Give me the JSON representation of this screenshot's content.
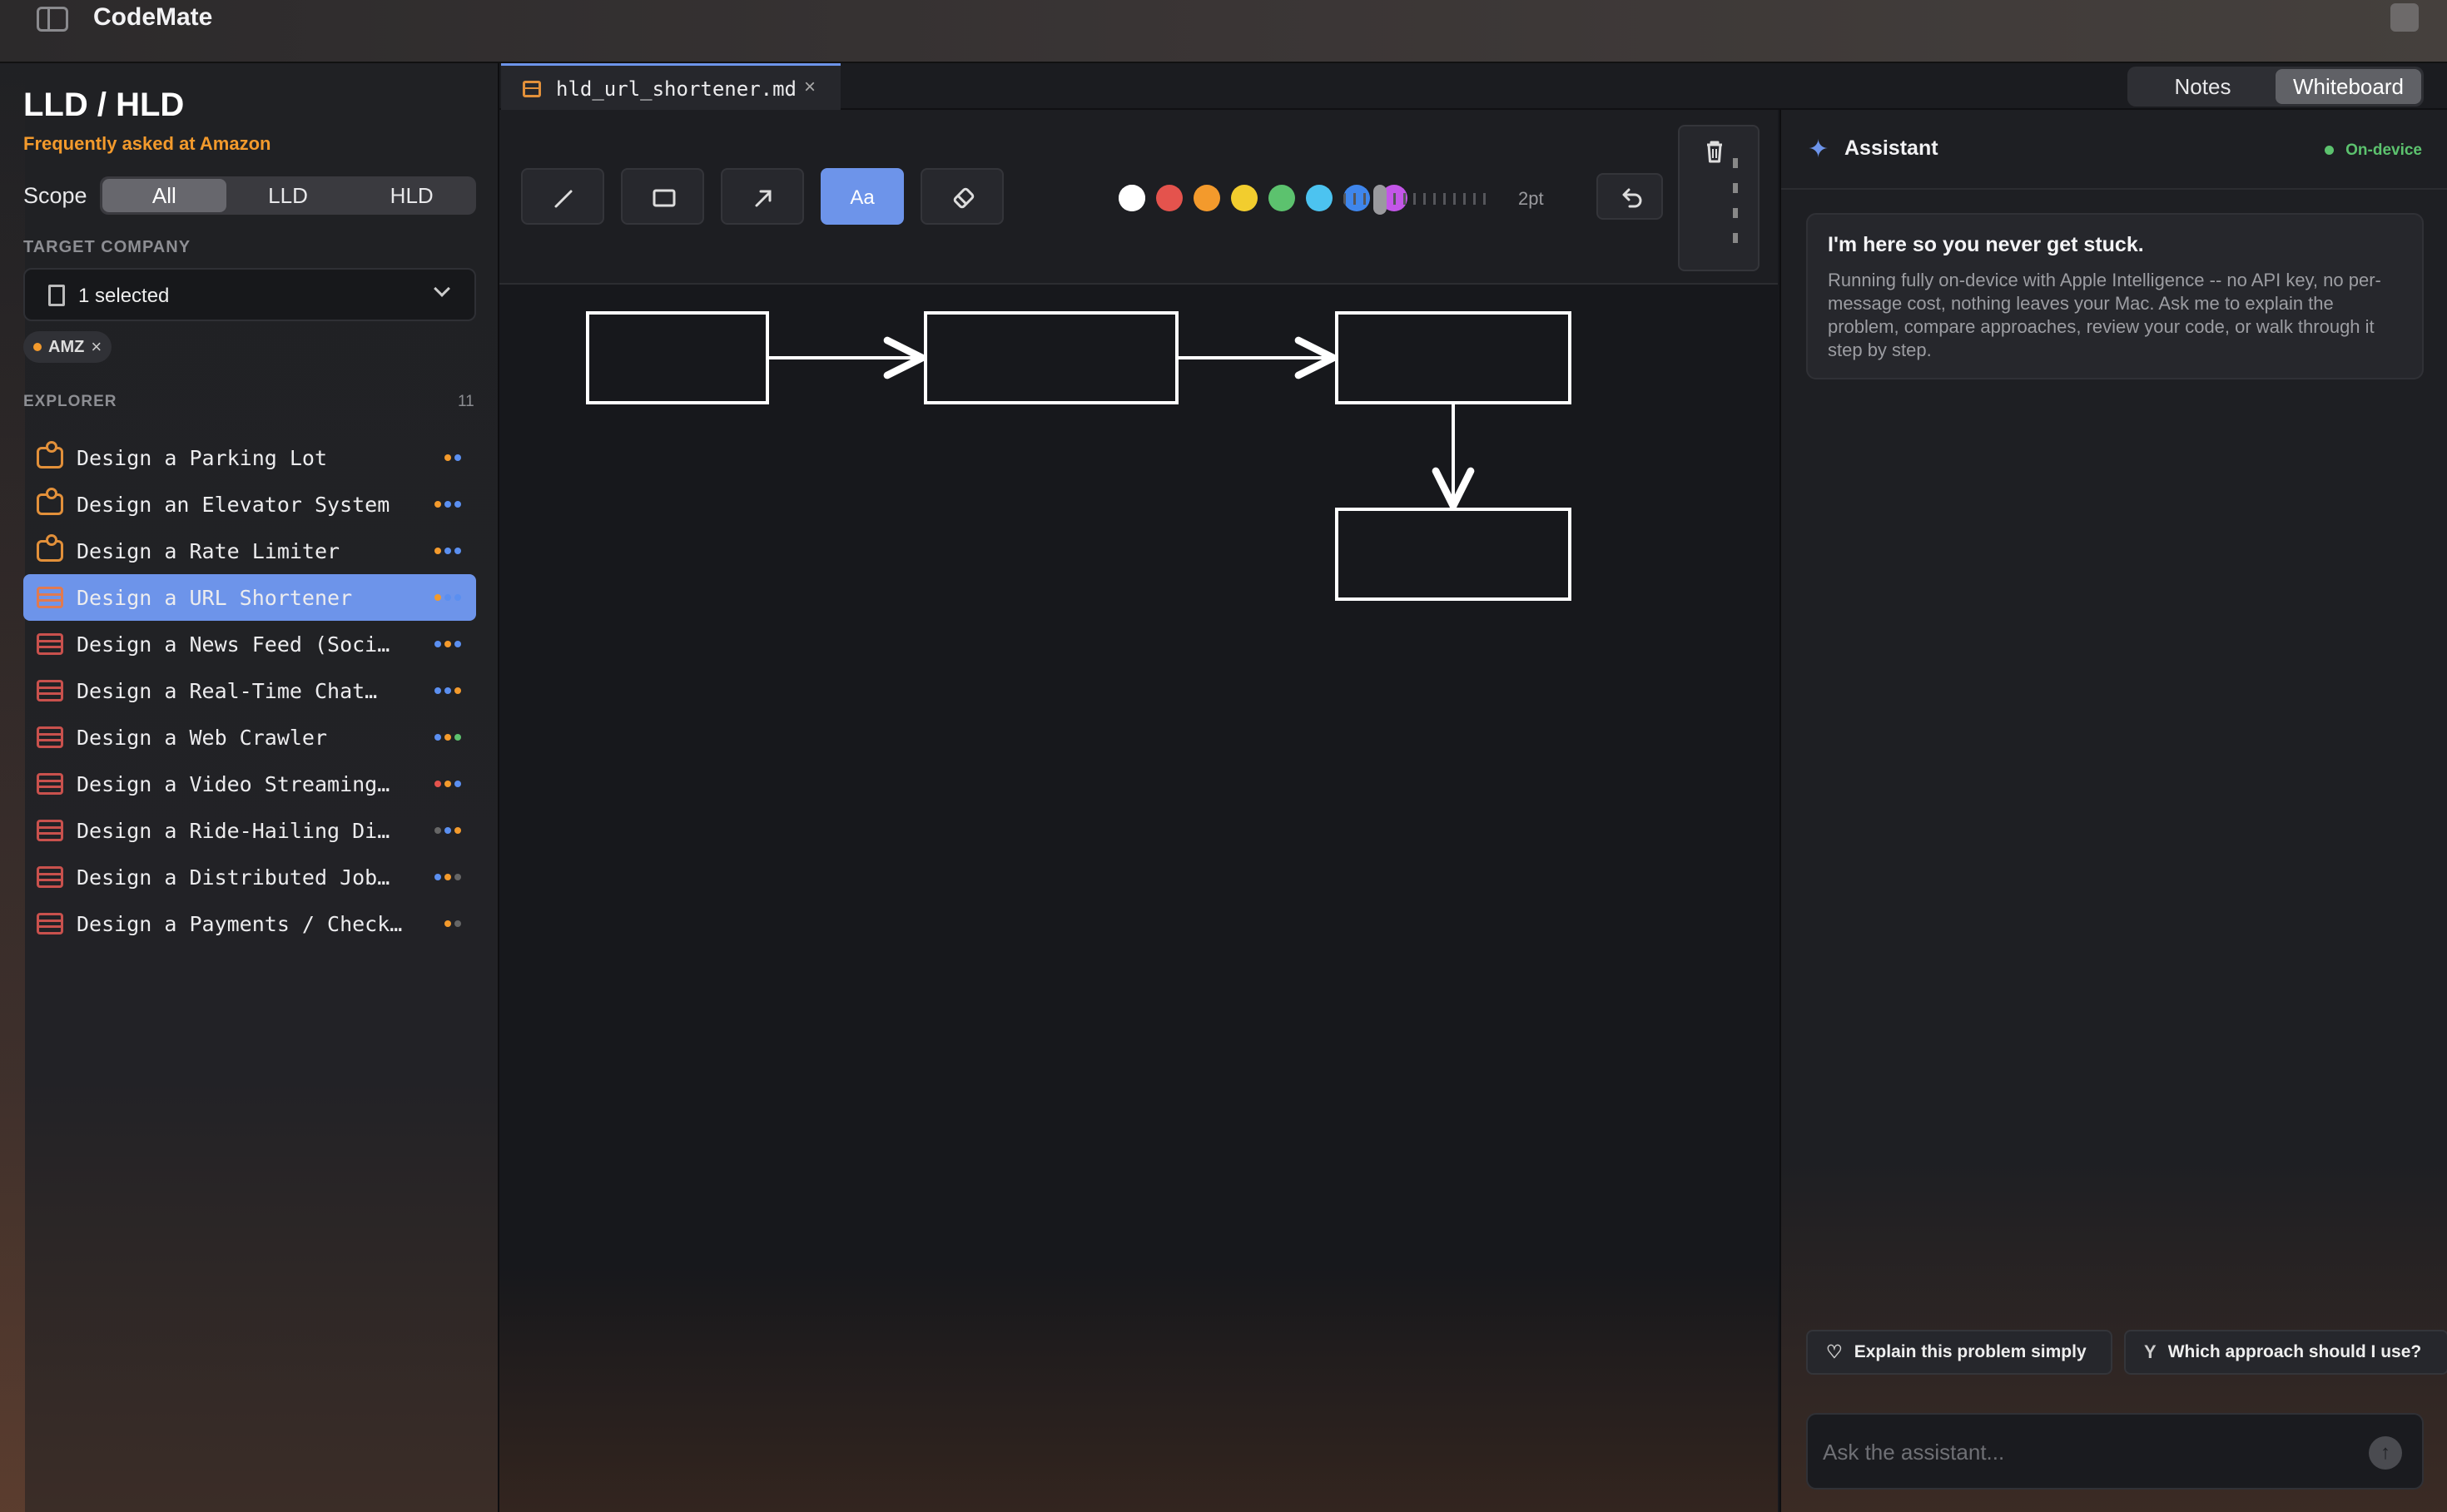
{
  "app": {
    "title": "CodeMate"
  },
  "sidebar": {
    "title": "LLD / HLD",
    "subtitle": "Frequently asked at Amazon",
    "scope_label": "Scope",
    "scope_options": [
      "All",
      "LLD",
      "HLD"
    ],
    "scope_selected": "All",
    "target_company_label": "TARGET COMPANY",
    "target_company_value": "1 selected",
    "chips": [
      {
        "label": "AMZ",
        "close": "×"
      }
    ],
    "explorer_label": "EXPLORER",
    "explorer_count": "11",
    "items": [
      {
        "label": "Design a Parking Lot",
        "type": "lld",
        "dots": [
          "#f39a2c",
          "#5b8ff0"
        ],
        "selected": false
      },
      {
        "label": "Design an Elevator System",
        "type": "lld",
        "dots": [
          "#f39a2c",
          "#5b8ff0",
          "#5b8ff0"
        ],
        "selected": false
      },
      {
        "label": "Design a Rate Limiter",
        "type": "lld",
        "dots": [
          "#f39a2c",
          "#5b8ff0",
          "#5b8ff0"
        ],
        "selected": false
      },
      {
        "label": "Design a URL Shortener",
        "type": "hld",
        "dots": [
          "#f39a2c",
          "#5b8ff0",
          "#5b8ff0"
        ],
        "selected": true
      },
      {
        "label": "Design a News Feed (Soci…",
        "type": "hld",
        "dots": [
          "#5b8ff0",
          "#f39a2c",
          "#5b8ff0"
        ],
        "selected": false
      },
      {
        "label": "Design a Real-Time Chat…",
        "type": "hld",
        "dots": [
          "#5b8ff0",
          "#5b8ff0",
          "#f39a2c"
        ],
        "selected": false
      },
      {
        "label": "Design a Web Crawler",
        "type": "hld",
        "dots": [
          "#5b8ff0",
          "#f39a2c",
          "#5cc26e"
        ],
        "selected": false
      },
      {
        "label": "Design a Video Streaming…",
        "type": "hld",
        "dots": [
          "#e4534d",
          "#f39a2c",
          "#5b8ff0"
        ],
        "selected": false
      },
      {
        "label": "Design a Ride-Hailing Di…",
        "type": "hld",
        "dots": [
          "#666",
          "#5b8ff0",
          "#f39a2c"
        ],
        "selected": false
      },
      {
        "label": "Design a Distributed Job…",
        "type": "hld",
        "dots": [
          "#5b8ff0",
          "#f39a2c",
          "#666"
        ],
        "selected": false
      },
      {
        "label": "Design a Payments / Check…",
        "type": "hld",
        "dots": [
          "#f39a2c",
          "#666"
        ],
        "selected": false
      }
    ]
  },
  "editor": {
    "tab_name": "hld_url_shortener.md",
    "tab_close": "×",
    "view_toggle": [
      "Notes",
      "Whiteboard"
    ],
    "view_selected": "Whiteboard",
    "tools": [
      "pen-tool",
      "rectangle-tool",
      "arrow-tool",
      "text-tool",
      "eraser-tool"
    ],
    "active_tool": "text-tool",
    "text_tool_label": "Aa",
    "colors": [
      "#ffffff",
      "#e4534d",
      "#f39a2c",
      "#f2cd2e",
      "#5cc26e",
      "#4cc3f0",
      "#3f86ec",
      "#c356e8"
    ],
    "selected_color": "#ffffff",
    "stroke_size_label": "2pt",
    "stroke_size_fraction": 0.2
  },
  "assistant": {
    "title": "Assistant",
    "status": "On-device",
    "message_title": "I'm here so you never get stuck.",
    "message_body": "Running fully on-device with Apple Intelligence -- no API key, no per-message cost, nothing leaves your Mac. Ask me to explain the problem, compare approaches, review your code, or walk through it step by step.",
    "suggestions": [
      "Explain this problem simply",
      "Which approach should I use?"
    ],
    "input_placeholder": "Ask the assistant..."
  }
}
